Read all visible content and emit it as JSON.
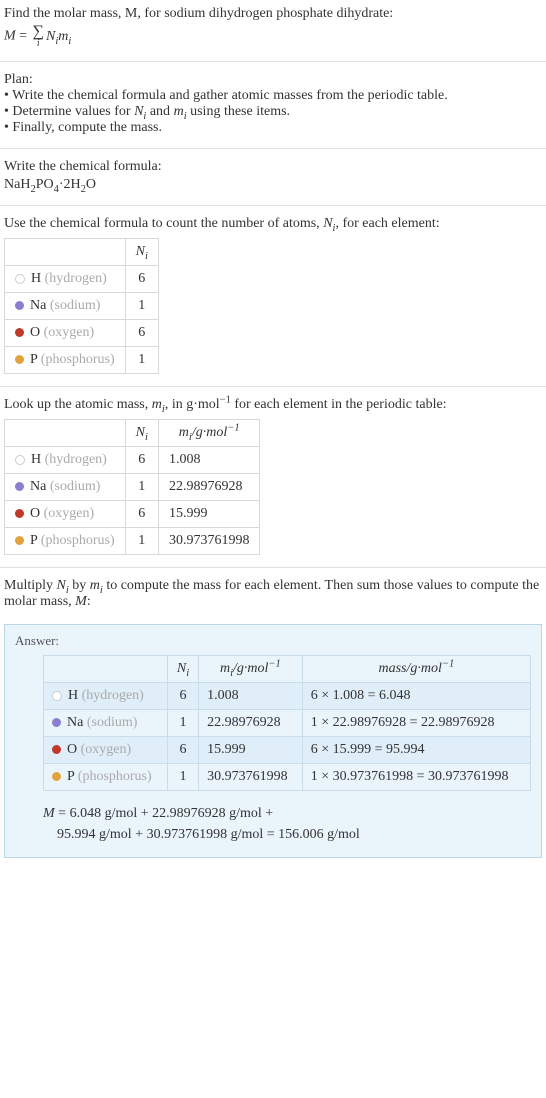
{
  "intro": {
    "line1": "Find the molar mass, M, for sodium dihydrogen phosphate dihydrate:",
    "eq_lhs": "M",
    "eq_eq": " = ",
    "eq_sigma": "∑",
    "eq_idx": "i",
    "eq_rhs": "Nᵢmᵢ"
  },
  "plan": {
    "title": "Plan:",
    "b1": "• Write the chemical formula and gather atomic masses from the periodic table.",
    "b2_a": "• Determine values for ",
    "b2_ni": "Nᵢ",
    "b2_b": " and ",
    "b2_mi": "mᵢ",
    "b2_c": " using these items.",
    "b3": "• Finally, compute the mass."
  },
  "formula_section": {
    "title": "Write the chemical formula:",
    "formula_html": "NaH2PO4·2H2O"
  },
  "count_section": {
    "title_a": "Use the chemical formula to count the number of atoms, ",
    "title_ni": "Nᵢ",
    "title_b": ", for each element:",
    "header_ni": "Nᵢ",
    "rows": [
      {
        "sym": "H",
        "name": "(hydrogen)",
        "n": "6",
        "cls": "h"
      },
      {
        "sym": "Na",
        "name": "(sodium)",
        "n": "1",
        "cls": "na"
      },
      {
        "sym": "O",
        "name": "(oxygen)",
        "n": "6",
        "cls": "o"
      },
      {
        "sym": "P",
        "name": "(phosphorus)",
        "n": "1",
        "cls": "p"
      }
    ]
  },
  "mass_section": {
    "title_a": "Look up the atomic mass, ",
    "title_mi": "mᵢ",
    "title_b": ", in g·mol",
    "title_c": " for each element in the periodic table:",
    "header_ni": "Nᵢ",
    "header_mi_a": "mᵢ",
    "header_mi_b": "/g·mol",
    "rows": [
      {
        "sym": "H",
        "name": "(hydrogen)",
        "n": "6",
        "m": "1.008",
        "cls": "h"
      },
      {
        "sym": "Na",
        "name": "(sodium)",
        "n": "1",
        "m": "22.98976928",
        "cls": "na"
      },
      {
        "sym": "O",
        "name": "(oxygen)",
        "n": "6",
        "m": "15.999",
        "cls": "o"
      },
      {
        "sym": "P",
        "name": "(phosphorus)",
        "n": "1",
        "m": "30.973761998",
        "cls": "p"
      }
    ]
  },
  "compute_section": {
    "text_a": "Multiply ",
    "text_ni": "Nᵢ",
    "text_b": " by ",
    "text_mi": "mᵢ",
    "text_c": " to compute the mass for each element. Then sum those values to compute the molar mass, ",
    "text_M": "M",
    "text_d": ":"
  },
  "answer": {
    "label": "Answer:",
    "header_ni": "Nᵢ",
    "header_mi_a": "mᵢ",
    "header_mi_b": "/g·mol",
    "header_mass": "mass/g·mol",
    "rows": [
      {
        "sym": "H",
        "name": "(hydrogen)",
        "n": "6",
        "m": "1.008",
        "mass": "6 × 1.008 = 6.048",
        "cls": "h"
      },
      {
        "sym": "Na",
        "name": "(sodium)",
        "n": "1",
        "m": "22.98976928",
        "mass": "1 × 22.98976928 = 22.98976928",
        "cls": "na"
      },
      {
        "sym": "O",
        "name": "(oxygen)",
        "n": "6",
        "m": "15.999",
        "mass": "6 × 15.999 = 95.994",
        "cls": "o"
      },
      {
        "sym": "P",
        "name": "(phosphorus)",
        "n": "1",
        "m": "30.973761998",
        "mass": "1 × 30.973761998 = 30.973761998",
        "cls": "p"
      }
    ],
    "eq_line1": "M = 6.048 g/mol + 22.98976928 g/mol +",
    "eq_line2": "95.994 g/mol + 30.973761998 g/mol = 156.006 g/mol"
  }
}
